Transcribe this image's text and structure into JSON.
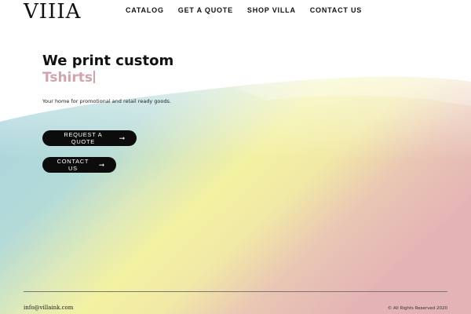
{
  "brand": {
    "logo_text": "VIIIA"
  },
  "nav": {
    "items": [
      {
        "label": "CATALOG"
      },
      {
        "label": "GET A QUOTE"
      },
      {
        "label": "SHOP VILLA"
      },
      {
        "label": "CONTACT US"
      }
    ]
  },
  "hero": {
    "title": "We print custom",
    "typed_word": "Tshirts",
    "tagline": "Your home for promotional and retail ready goods."
  },
  "buttons": {
    "request_quote": {
      "label": "REQUEST A QUOTE",
      "icon": "arrow-right-icon",
      "arrow": "➞"
    },
    "contact_us": {
      "label": "CONTACT US",
      "icon": "arrow-right-icon",
      "arrow": "➞"
    }
  },
  "footer": {
    "email": "info@villaink.com",
    "copyright": "© All Rights Reserved 2020"
  },
  "colors": {
    "accent_pink": "#d2a3ab",
    "wave_blue": "#a9d4de",
    "wave_yellow": "#f2f0a0",
    "wave_pink": "#e4b6b6",
    "button_bg": "#0c0c0c"
  }
}
